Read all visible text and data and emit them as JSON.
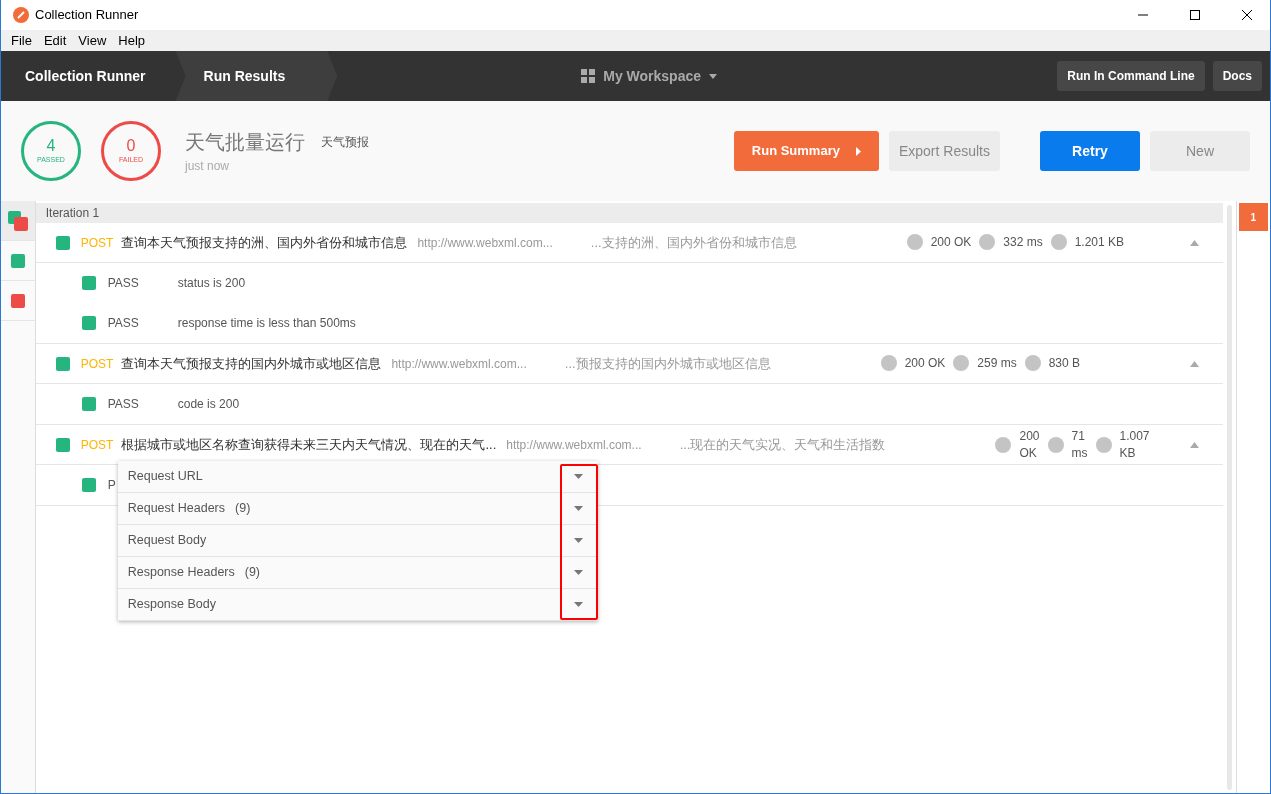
{
  "window": {
    "title": "Collection Runner"
  },
  "menu": [
    "File",
    "Edit",
    "View",
    "Help"
  ],
  "breadcrumbs": [
    {
      "label": "Collection Runner",
      "selected": false
    },
    {
      "label": "Run Results",
      "selected": true
    }
  ],
  "workspace": "My Workspace",
  "header_buttons": [
    "Run In Command Line",
    "Docs"
  ],
  "summary": {
    "passed": {
      "count": "4",
      "label": "PASSED"
    },
    "failed": {
      "count": "0",
      "label": "FAILED"
    },
    "title": "天气批量运行",
    "collection": "天气预报",
    "time": "just now"
  },
  "actions": [
    {
      "label": "Run Summary",
      "kind": "summary"
    },
    {
      "label": "Export Results",
      "kind": "secondary"
    },
    {
      "label": "Retry",
      "kind": "primary"
    },
    {
      "label": "New",
      "kind": "secondary"
    }
  ],
  "iteration_tabs": [
    {
      "kind": "mixed",
      "selected": true
    },
    {
      "kind": "pass",
      "selected": false
    },
    {
      "kind": "fail",
      "selected": false
    }
  ],
  "iteration": {
    "label": "Iteration 1",
    "requests": [
      {
        "method": "POST",
        "name": "查询本天气预报支持的洲、国内外省份和城市信息",
        "url": "http://www.webxml.com...",
        "response": "...支持的洲、国内外省份和城市信息",
        "status": "200 OK",
        "time": "332 ms",
        "size": "1.201 KB",
        "passed": true,
        "expanded": true,
        "tests": [
          {
            "result": "PASS",
            "name": "status is 200",
            "passed": true
          },
          {
            "result": "PASS",
            "name": "response time is less than 500ms",
            "passed": true
          }
        ]
      },
      {
        "method": "POST",
        "name": "查询本天气预报支持的国内外城市或地区信息",
        "url": "http://www.webxml.com...",
        "response": "...预报支持的国内外城市或地区信息",
        "status": "200 OK",
        "time": "259 ms",
        "size": "830 B",
        "passed": true,
        "expanded": true,
        "tests": [
          {
            "result": "PASS",
            "name": "code is 200",
            "passed": true
          }
        ]
      },
      {
        "method": "POST",
        "name": "根据城市或地区名称查询获得未来三天内天气情况、现在的天气...",
        "url": "http://www.webxml.com...",
        "response": "...现在的天气实况、天气和生活指数",
        "status": "200 OK",
        "time": "71 ms",
        "size": "1.007 KB",
        "passed": true,
        "expanded": true,
        "tests": [
          {
            "result": "P",
            "passed": true
          }
        ]
      }
    ]
  },
  "popup": {
    "highlighted": true,
    "items": [
      {
        "label": "Request URL"
      },
      {
        "label": "Request Headers",
        "count": "(9)"
      },
      {
        "label": "Request Body"
      },
      {
        "label": "Response Headers",
        "count": "(9)"
      },
      {
        "label": "Response Body"
      }
    ]
  },
  "iteration_markers": [
    {
      "label": "1",
      "selected": true
    }
  ]
}
